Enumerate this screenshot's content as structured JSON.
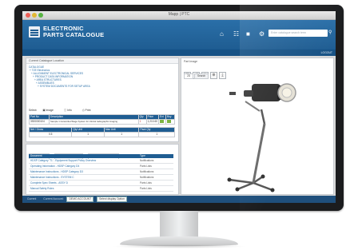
{
  "window": {
    "title": "Mapp | PTC"
  },
  "app": {
    "title_line1": "ELECTRONIC",
    "title_line2": "PARTS CATALOGUE",
    "search_placeholder": "Enter catalogue search term",
    "icons": [
      "home-icon",
      "hierarchy-icon",
      "cart-icon",
      "settings-icon",
      "search-icon"
    ]
  },
  "nav": {
    "items": [
      "CATALOGUE",
      "PRODUCTS",
      "CLASSES",
      "ORDERS",
      "DOCUMENTS",
      "OPTIONS",
      "CONTACT US",
      "HISTORY"
    ],
    "right": "LOGOUT"
  },
  "left_panel": {
    "header": "Current Catalogue Location",
    "tree": [
      "CATALOGUE",
      "+ TZE Electronics",
      "  + ALLIGNMENT ELECTRONICAL SERVICES",
      "    + PRODUCT DATA INFORMATION",
      "      + AREA STRUCTURES",
      "        + ASSEMBLIES",
      "          + SYSTEM DOCUMENTS FOR SETUP AREA"
    ]
  },
  "part_tools": {
    "label": "Select:",
    "items": [
      "Image",
      "Info",
      "Print"
    ]
  },
  "parts_table": {
    "headers": [
      "Part No",
      "Description",
      "Qty",
      "Price",
      "Ext",
      "Buy"
    ],
    "row": [
      "3920000104",
      "Sample 1 transmitter/Stage System for clinical radiographic imaging",
      "1",
      "1,210.60",
      "",
      ""
    ],
    "summary_headers": [
      "Net / Gross",
      "Qty Unit",
      "Max Unit",
      "Pack Qty"
    ],
    "summary_values": [
      "0.5",
      "1",
      "1",
      "1"
    ]
  },
  "docs": {
    "tabs": [
      "Notifications",
      "Related Parts Lists",
      "Related Order Lists"
    ],
    "active_tab": 2,
    "headers": [
      "Document",
      "Type"
    ],
    "rows": [
      [
        "HDSP Category 'T1' - Equipment Support Policy Overview",
        "Notifications"
      ],
      [
        "Operating Information - HDSP Category D4",
        "Parts Lists"
      ],
      [
        "Maintenance Instructions - HDSP Category D3",
        "Notifications"
      ],
      [
        "Maintenance Instructions - SYSTEM C",
        "Notifications"
      ],
      [
        "Complete Spec Sheets - ASSY D",
        "Parts Lists"
      ],
      [
        "Manual Safety Rules",
        "Parts Lists"
      ]
    ]
  },
  "preview": {
    "label": "Part Image",
    "tools": [
      "fit-icon",
      "expand-icon",
      "zoom-out-icon",
      "zoom-in-icon",
      "download-icon"
    ],
    "tabs": [
      "2D",
      "Search"
    ]
  },
  "footer": {
    "label1": "Current",
    "label2": "Current Account:",
    "select1": "DEMO ACCOUNT",
    "select2": "Select display Option"
  }
}
